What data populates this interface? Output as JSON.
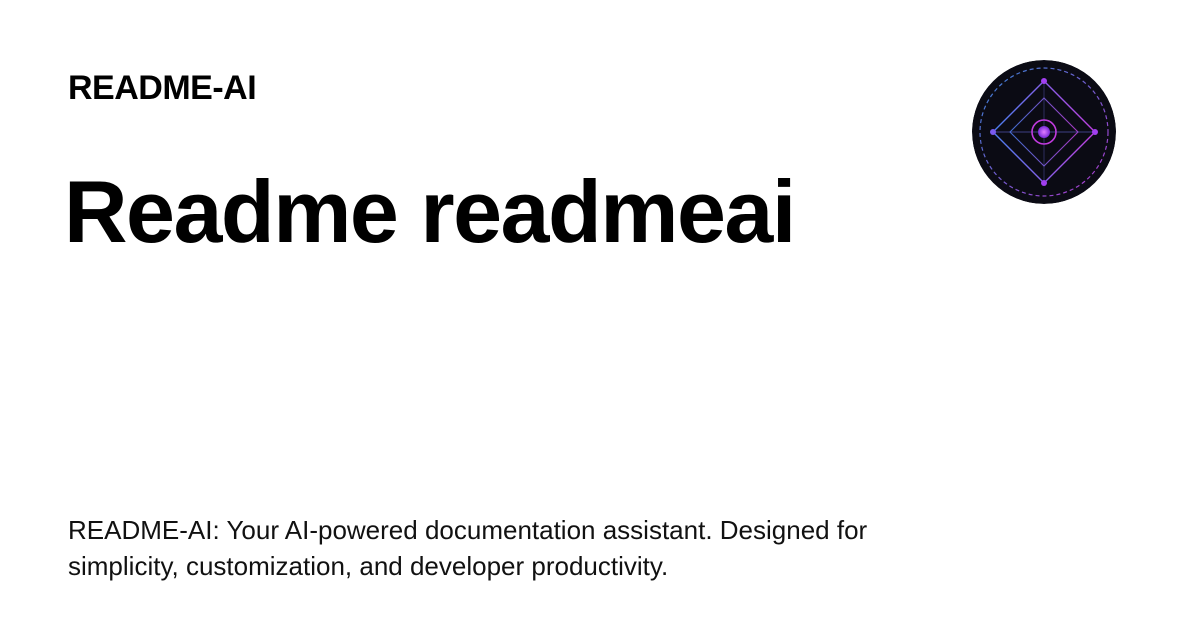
{
  "header": {
    "site_name": "README-AI"
  },
  "main": {
    "title": "Readme readmeai",
    "description": "README-AI: Your AI-powered documentation assistant. Designed for simplicity, customization, and developer productivity."
  },
  "logo": {
    "icon": "readme-ai-logo-icon",
    "colors": {
      "background": "#0b0b14",
      "ring_blue": "#3a8fe8",
      "ring_magenta": "#c23be0",
      "core": "#a23ff0"
    }
  }
}
